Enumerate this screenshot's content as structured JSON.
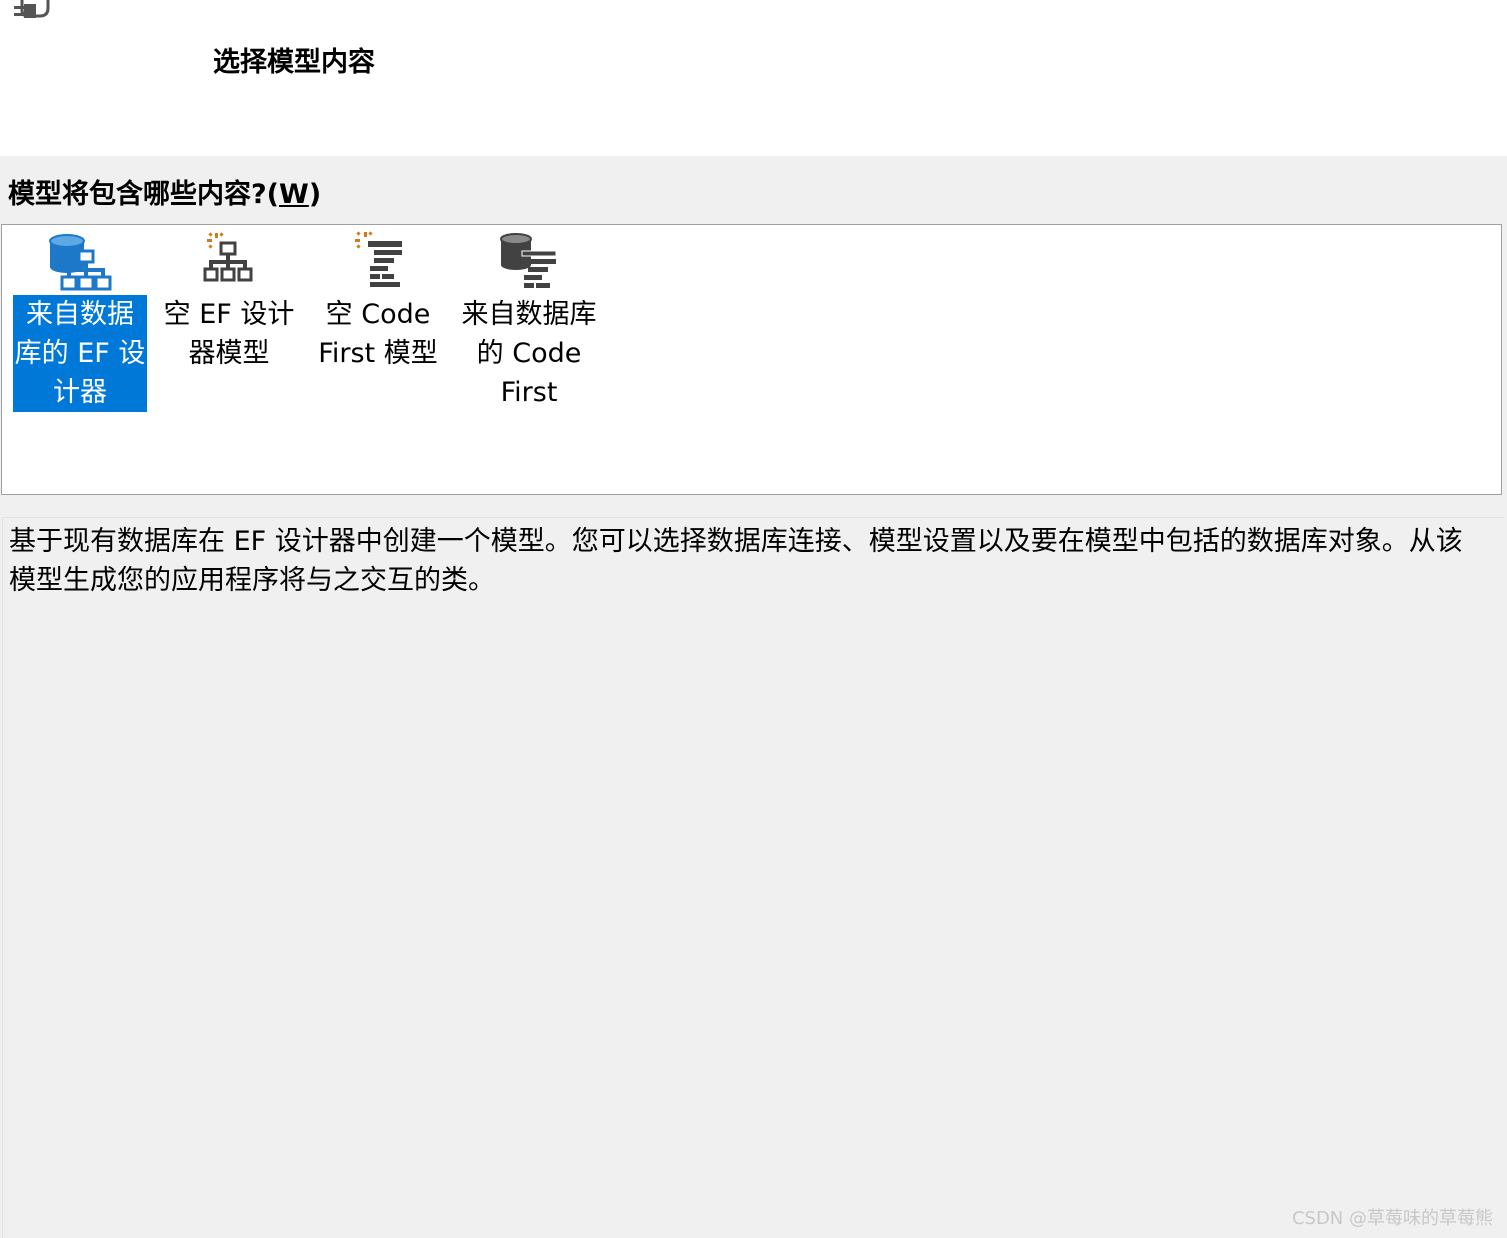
{
  "header": {
    "title": "选择模型内容",
    "icon": "wizard-plug-icon"
  },
  "question": {
    "label": "模型将包含哪些内容?(",
    "accelerator": "W",
    "label_end": ")"
  },
  "model_options": [
    {
      "label": "来自数据库的 EF 设计器",
      "lines": [
        "来自数据",
        "库的 EF 设",
        "计器"
      ],
      "icon": "database-designer-icon",
      "selected": true
    },
    {
      "label": "空 EF 设计器模型",
      "lines": [
        "空 EF 设计",
        "器模型"
      ],
      "icon": "empty-designer-icon",
      "selected": false
    },
    {
      "label": "空 Code First 模型",
      "lines": [
        "空 Code",
        "First 模型"
      ],
      "icon": "empty-code-first-icon",
      "selected": false
    },
    {
      "label": "来自数据库的 Code First",
      "lines": [
        "来自数据库",
        "的 Code",
        "First"
      ],
      "icon": "database-code-first-icon",
      "selected": false
    }
  ],
  "description": "基于现有数据库在 EF 设计器中创建一个模型。您可以选择数据库连接、模型设置以及要在模型中包括的数据库对象。从该模型生成您的应用程序将与之交互的类。",
  "watermark": "CSDN @草莓味的草莓熊",
  "colors": {
    "selection": "#0078d7",
    "icon_blue": "#1e78c8",
    "icon_dark": "#424242",
    "icon_orange": "#d47a1c"
  }
}
